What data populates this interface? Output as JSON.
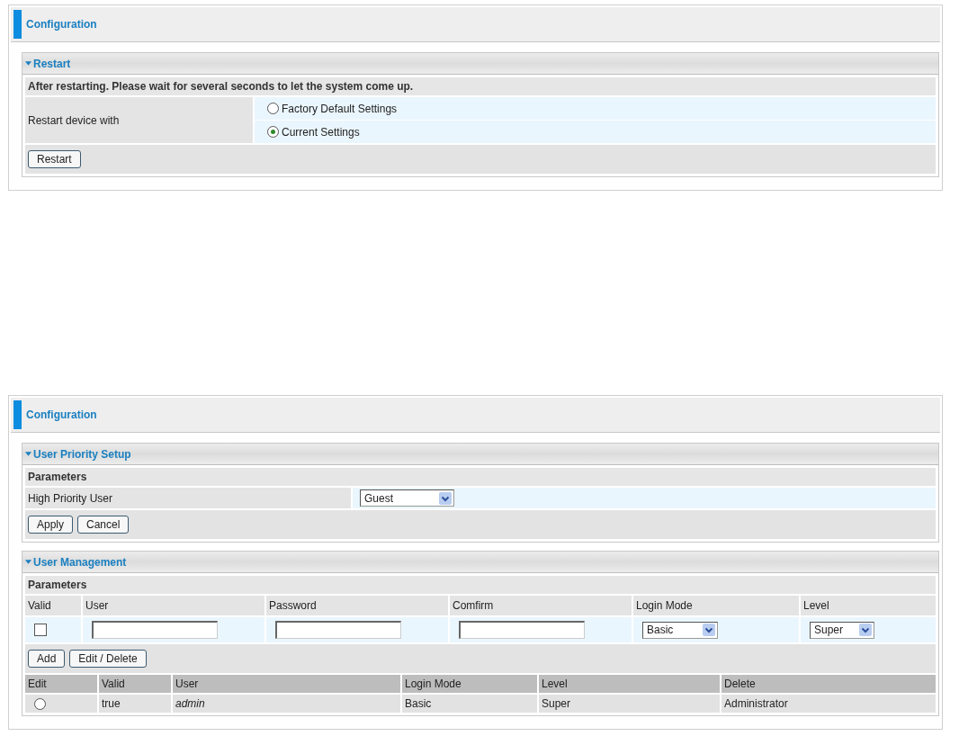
{
  "restart_panel": {
    "title": "Configuration",
    "section": {
      "title": "Restart",
      "notice": "After restarting. Please wait for several seconds to let the system come up.",
      "field_label": "Restart device with",
      "options": [
        {
          "label": "Factory Default Settings",
          "selected": false
        },
        {
          "label": "Current Settings",
          "selected": true
        }
      ],
      "buttons": [
        "Restart"
      ]
    }
  },
  "user_panel": {
    "title": "Configuration",
    "priority_section": {
      "title": "User Priority Setup",
      "subheading": "Parameters",
      "field_label": "High Priority User",
      "select_value": "Guest",
      "buttons": [
        "Apply",
        "Cancel"
      ]
    },
    "management_section": {
      "title": "User Management",
      "subheading": "Parameters",
      "input_columns": [
        "Valid",
        "User",
        "Password",
        "Comfirm",
        "Login Mode",
        "Level"
      ],
      "new_user": {
        "valid": false,
        "login_mode": "Basic",
        "level": "Super"
      },
      "buttons": [
        "Add",
        "Edit / Delete"
      ],
      "table": {
        "columns": [
          "Edit",
          "Valid",
          "User",
          "Login Mode",
          "Level",
          "Delete"
        ],
        "rows": [
          {
            "selected": false,
            "valid": "true",
            "user": "admin",
            "login_mode": "Basic",
            "level": "Super",
            "delete": "Administrator"
          }
        ]
      }
    }
  }
}
